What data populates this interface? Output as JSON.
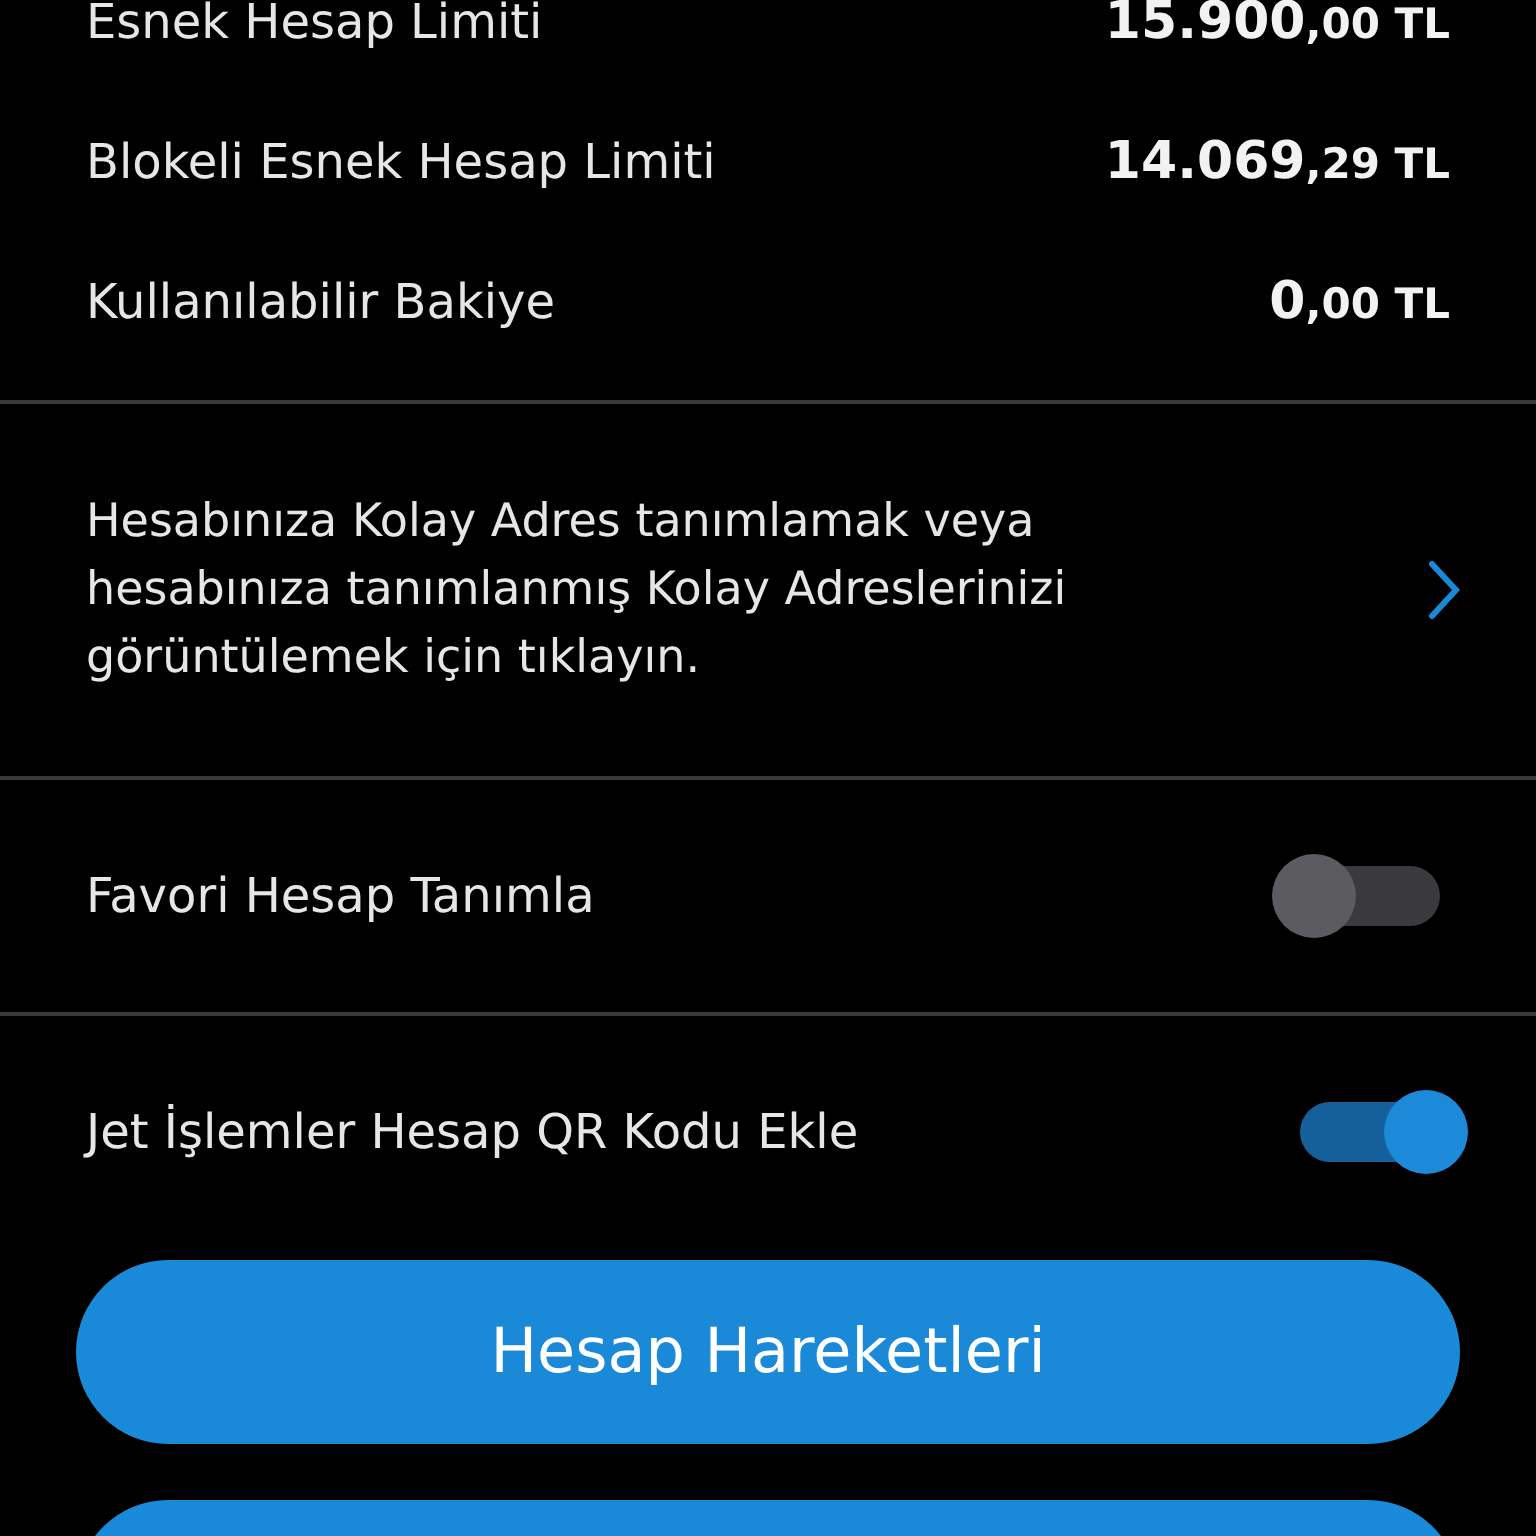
{
  "balances": [
    {
      "label": "Esnek Hesap Limiti",
      "amount": "15.900",
      "decimals": ",00",
      "currency": "TL"
    },
    {
      "label": "Blokeli Esnek Hesap Limiti",
      "amount": "14.069",
      "decimals": ",29",
      "currency": "TL"
    },
    {
      "label": "Kullanılabilir Bakiye",
      "amount": "0",
      "decimals": ",00",
      "currency": "TL"
    }
  ],
  "kolay_adres_link": {
    "text": "Hesabınıza Kolay Adres tanımlamak veya hesabınıza tanımlanmış Kolay Adreslerinizi görüntülemek için tıklayın."
  },
  "toggles": [
    {
      "label": "Favori Hesap Tanımla",
      "on": false
    },
    {
      "label": "Jet İşlemler Hesap QR Kodu Ekle",
      "on": true
    }
  ],
  "buttons": [
    {
      "kind": "labeled",
      "label": "Hesap Hareketleri"
    },
    {
      "kind": "blank"
    }
  ]
}
